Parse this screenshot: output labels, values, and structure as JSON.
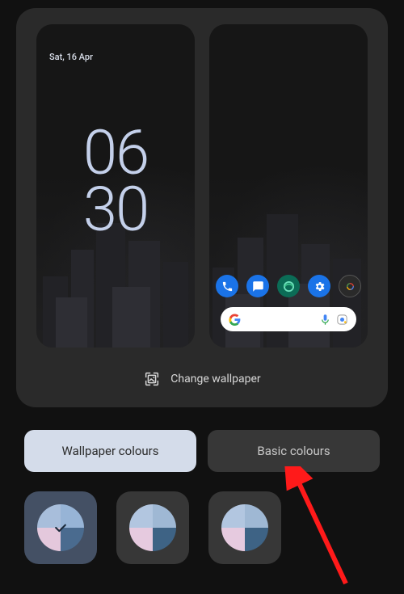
{
  "preview": {
    "lock": {
      "date": "Sat, 16 Apr",
      "clock_hours": "06",
      "clock_minutes": "30"
    },
    "home": {
      "dock_apps": [
        {
          "name": "phone",
          "bg": "#1a73e8"
        },
        {
          "name": "messages",
          "bg": "#1a73e8"
        },
        {
          "name": "browser-edge",
          "bg": "#0b6c56"
        },
        {
          "name": "settings",
          "bg": "#1a73e8"
        },
        {
          "name": "camera",
          "bg": "#2a2a2a"
        }
      ]
    },
    "change_label": "Change wallpaper"
  },
  "tabs": {
    "wallpaper": "Wallpaper colours",
    "basic": "Basic colours",
    "active": "wallpaper"
  },
  "swatches": [
    {
      "selected": true,
      "colors": [
        "#a8bedb",
        "#97b4d6",
        "#e4c8dc",
        "#4a6b8f"
      ]
    },
    {
      "selected": false,
      "colors": [
        "#b2c6e0",
        "#9fb8d4",
        "#e6cadf",
        "#3e6385"
      ]
    },
    {
      "selected": false,
      "colors": [
        "#b2c6e0",
        "#9fb8d4",
        "#e6cadf",
        "#3e6385"
      ]
    }
  ],
  "annotation": {
    "arrow_target": "tab-basic-colours",
    "arrow_color": "#ff1a1a"
  }
}
